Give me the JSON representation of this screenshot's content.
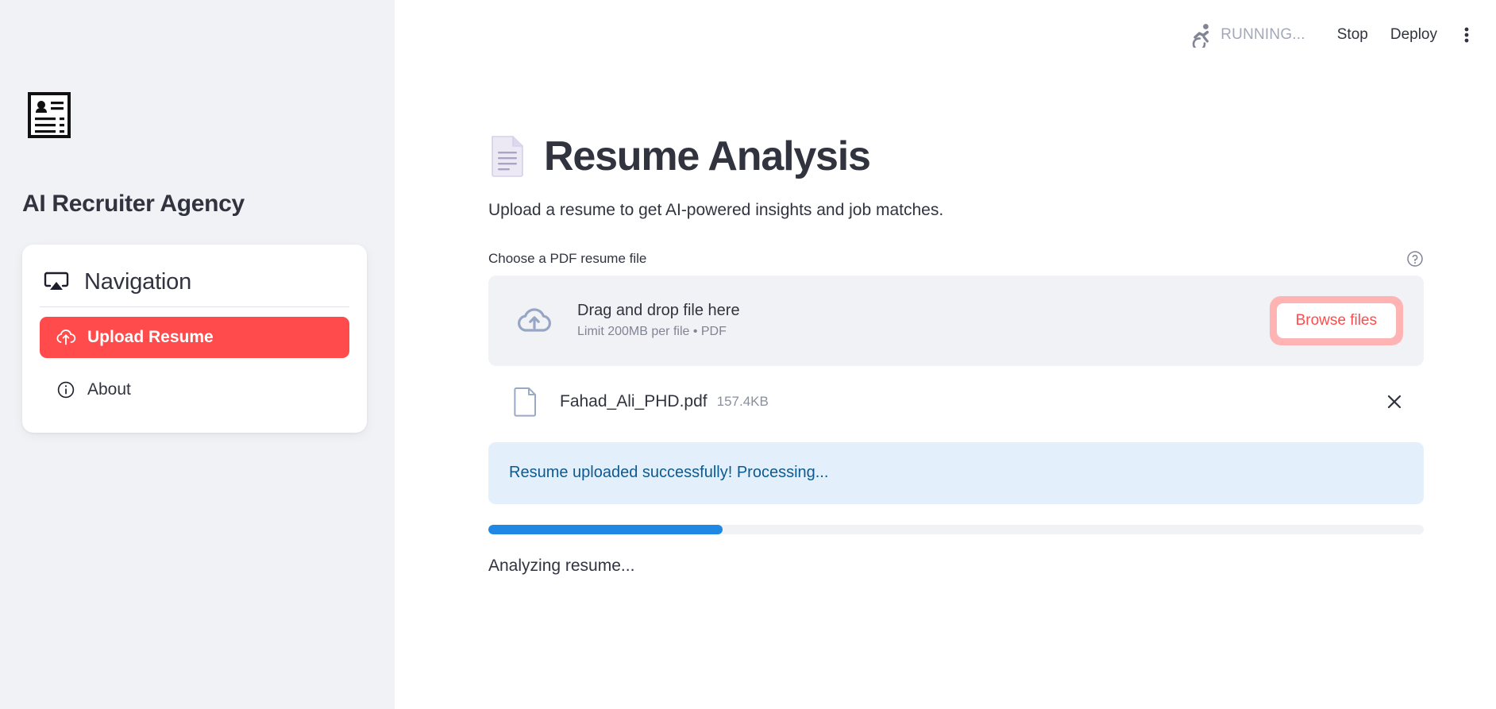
{
  "topbar": {
    "status_label": "RUNNING...",
    "stop_label": "Stop",
    "deploy_label": "Deploy",
    "run_icon": "running-person-icon",
    "menu_icon": "vertical-dots-icon"
  },
  "sidebar": {
    "logo_icon": "resume-card-icon",
    "app_title": "AI Recruiter Agency",
    "nav": {
      "header_icon": "airplay-screen-icon",
      "header_title": "Navigation",
      "items": [
        {
          "label": "Upload Resume",
          "icon": "cloud-upload-icon",
          "active": true
        },
        {
          "label": "About",
          "icon": "info-circle-icon",
          "active": false
        }
      ]
    }
  },
  "main": {
    "page_icon": "page-facing-up-emoji",
    "page_title": "Resume Analysis",
    "page_subtitle": "Upload a resume to get AI-powered insights and job matches.",
    "uploader": {
      "field_label": "Choose a PDF resume file",
      "help_icon": "question-circle-icon",
      "drop_title": "Drag and drop file here",
      "drop_hint": "Limit 200MB per file • PDF",
      "browse_label": "Browse files",
      "browse_highlight_color": "#ffb3b3",
      "browse_text_color": "#ff4b4b"
    },
    "uploaded_file": {
      "icon": "file-document-icon",
      "name": "Fahad_Ali_PHD.pdf",
      "size": "157.4KB",
      "remove_icon": "close-x-icon"
    },
    "alert": {
      "text": "Resume uploaded successfully! Processing...",
      "background": "#e3f0fb",
      "text_color": "#0c5a91"
    },
    "progress": {
      "percent": 25,
      "fill_color": "#1f88e5",
      "track_color": "#f0f2f6"
    },
    "status_text": "Analyzing resume..."
  },
  "colors": {
    "sidebar_bg": "#f0f2f6",
    "accent_red": "#ff4b4b",
    "text_primary": "#31333f"
  }
}
